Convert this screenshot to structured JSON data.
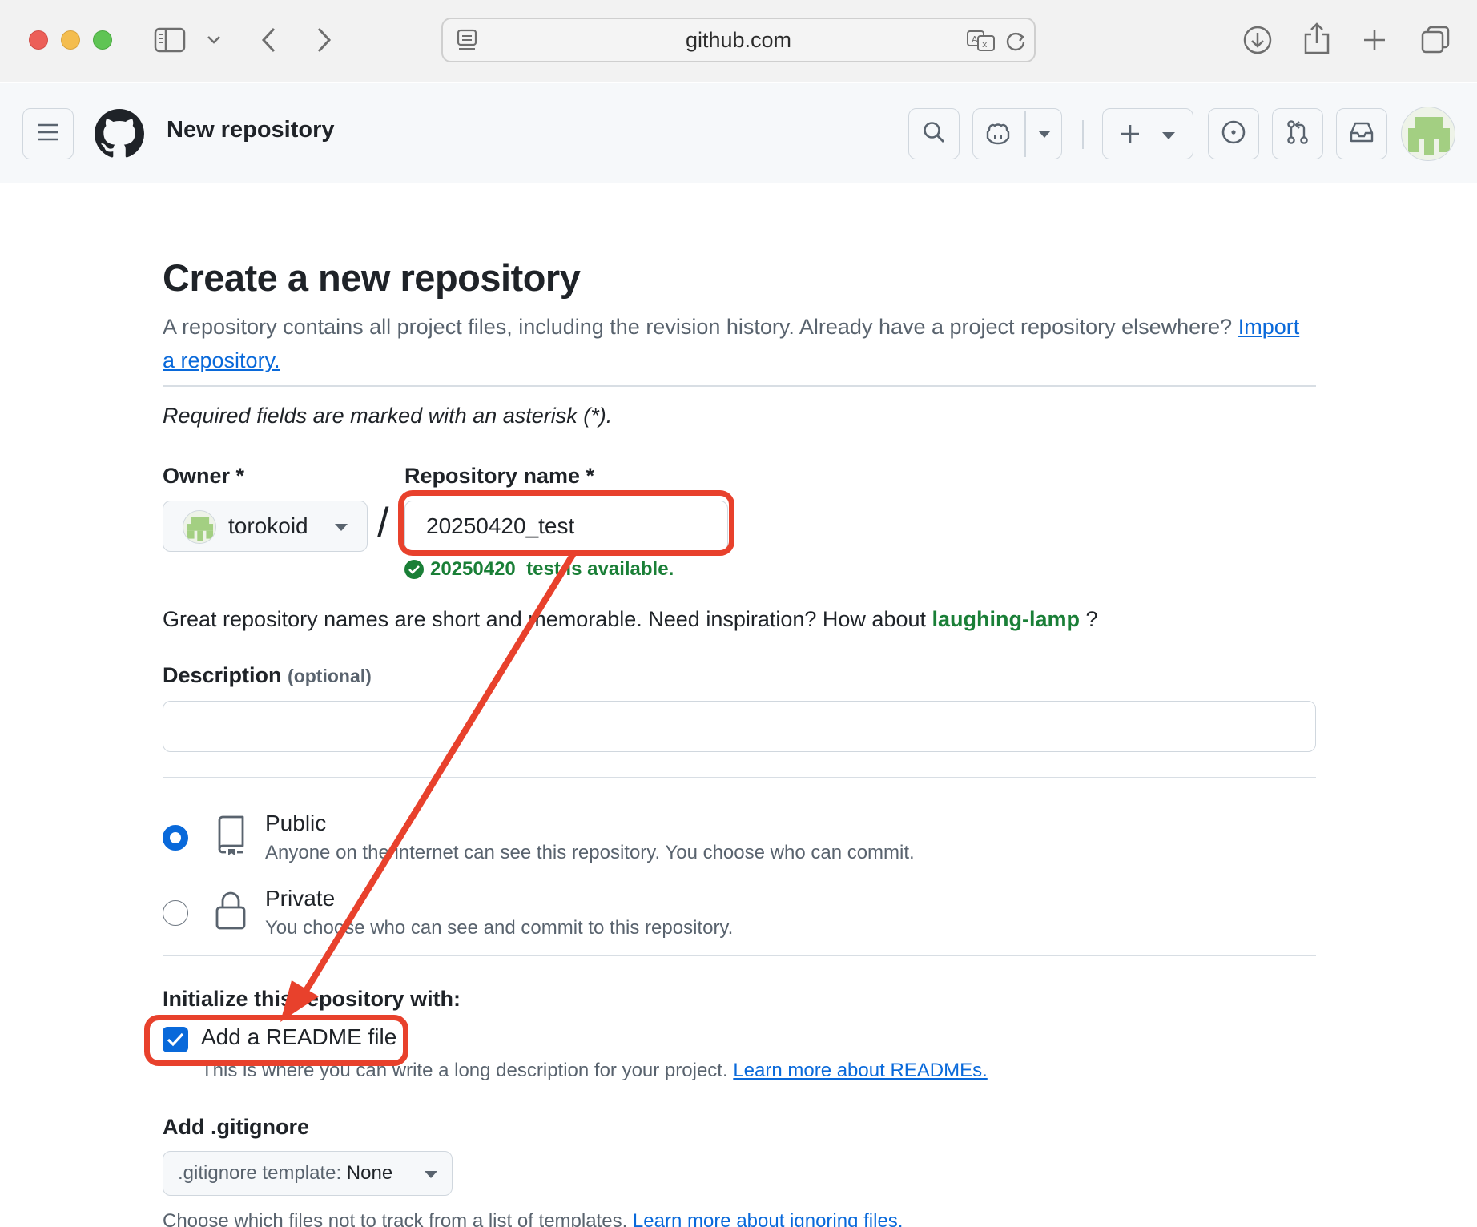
{
  "browser": {
    "address": "github.com"
  },
  "header": {
    "title": "New repository"
  },
  "page": {
    "heading": "Create a new repository",
    "lead_text": "A repository contains all project files, including the revision history. Already have a project repository elsewhere?",
    "import_link": "Import a repository.",
    "required_note": "Required fields are marked with an asterisk (*).",
    "owner_label": "Owner *",
    "owner_value": "torokoid",
    "slash": "/",
    "repo_name_label": "Repository name *",
    "repo_name_value": "20250420_test",
    "availability": "20250420_test is available.",
    "inspiration_text": "Great repository names are short and memorable. Need inspiration? How about",
    "inspiration_suggestion": "laughing-lamp",
    "inspiration_end": "?",
    "description_label": "Description",
    "description_optional": "(optional)",
    "description_value": "",
    "visibility": {
      "public_title": "Public",
      "public_desc": "Anyone on the internet can see this repository. You choose who can commit.",
      "private_title": "Private",
      "private_desc": "You choose who can see and commit to this repository.",
      "selected": "public"
    },
    "init_label": "Initialize this repository with:",
    "readme_label": "Add a README file",
    "readme_checked": true,
    "readme_desc": "This is where you can write a long description for your project.",
    "readme_link": "Learn more about READMEs.",
    "gitignore_label": "Add .gitignore",
    "gitignore_prefix": ".gitignore template:",
    "gitignore_value": "None",
    "gitignore_desc": "Choose which files not to track from a list of templates.",
    "gitignore_link": "Learn more about ignoring files."
  },
  "colors": {
    "accent": "#0969da",
    "success": "#1a7f37",
    "annotation": "#e8412c"
  }
}
